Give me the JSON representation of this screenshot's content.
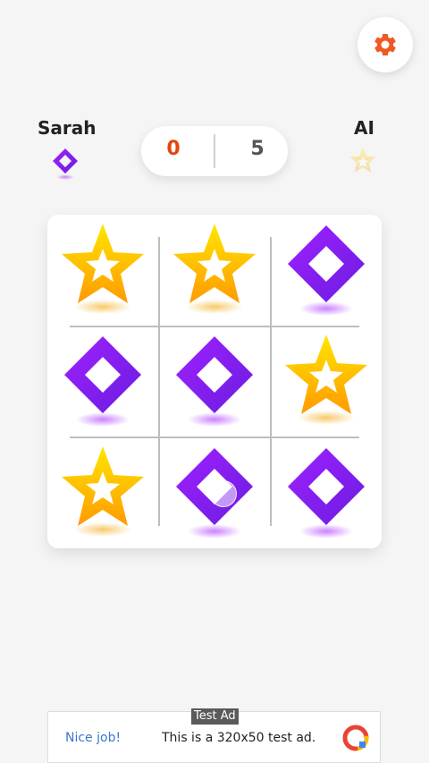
{
  "colors": {
    "background": "#f4f5f4",
    "player1_score": "#e2470b",
    "player2_score": "#555555",
    "settings_icon": "#f05a22",
    "diamond": "#8a2be2",
    "star": "#ffc200"
  },
  "header": {
    "settings_icon": "gear-icon"
  },
  "players": {
    "player1": {
      "name": "Sarah",
      "mark": "diamond",
      "score": "0"
    },
    "player2": {
      "name": "AI",
      "mark": "star",
      "score": "5"
    }
  },
  "board": {
    "cells": [
      "star",
      "star",
      "diamond",
      "diamond",
      "diamond",
      "star",
      "star",
      "diamond",
      "diamond"
    ]
  },
  "ad": {
    "tag": "Test Ad",
    "cta": "Nice job!",
    "text": "This is a 320x50 test ad."
  }
}
